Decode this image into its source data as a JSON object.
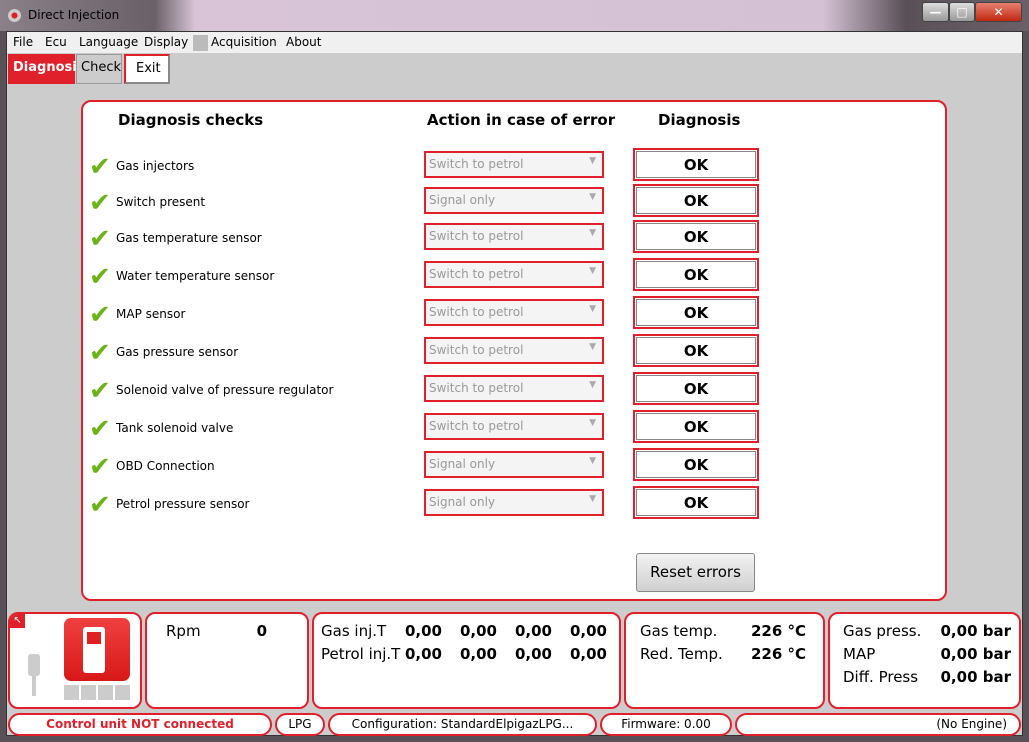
{
  "window": {
    "title": "Direct Injection",
    "minimize": "—",
    "maximize": "□",
    "close": "✕"
  },
  "menu": [
    "File",
    "Ecu",
    "Language",
    "Display",
    "Acquisition",
    "About"
  ],
  "tabs": [
    {
      "label": "Diagnosis",
      "active": true
    },
    {
      "label": "Check"
    },
    {
      "label": "Exit"
    }
  ],
  "headers": {
    "checks": "Diagnosis checks",
    "action": "Action in case of error",
    "diagnosis": "Diagnosis"
  },
  "checks": [
    {
      "label": "Gas injectors",
      "action": "Switch to petrol",
      "status": "OK"
    },
    {
      "label": "Switch present",
      "action": "Signal only",
      "status": "OK"
    },
    {
      "label": "Gas temperature sensor",
      "action": "Switch to petrol",
      "status": "OK"
    },
    {
      "label": "Water temperature sensor",
      "action": "Switch to petrol",
      "status": "OK"
    },
    {
      "label": "MAP sensor",
      "action": "Switch to petrol",
      "status": "OK"
    },
    {
      "label": "Gas pressure sensor",
      "action": "Switch to petrol",
      "status": "OK"
    },
    {
      "label": "Solenoid valve of pressure regulator",
      "action": "Switch to petrol",
      "status": "OK"
    },
    {
      "label": "Tank solenoid valve",
      "action": "Switch to petrol",
      "status": "OK"
    },
    {
      "label": "OBD Connection",
      "action": "Signal only",
      "status": "OK"
    },
    {
      "label": "Petrol pressure sensor",
      "action": "Signal only",
      "status": "OK"
    }
  ],
  "reset_label": "Reset errors",
  "gauges": {
    "rpm": {
      "label": "Rpm",
      "value": "0"
    },
    "gas_inj": {
      "label": "Gas inj.T",
      "values": [
        "0,00",
        "0,00",
        "0,00",
        "0,00"
      ]
    },
    "petrol_inj": {
      "label": "Petrol inj.T",
      "values": [
        "0,00",
        "0,00",
        "0,00",
        "0,00"
      ]
    },
    "gas_temp": {
      "label": "Gas temp.",
      "value": "226 °C"
    },
    "red_temp": {
      "label": "Red. Temp.",
      "value": "226 °C"
    },
    "gas_press": {
      "label": "Gas press.",
      "value": "0,00 bar"
    },
    "map": {
      "label": "MAP",
      "value": "0,00 bar"
    },
    "diff_press": {
      "label": "Diff. Press",
      "value": "0,00 bar"
    }
  },
  "status": {
    "connection": "Control unit NOT connected",
    "fuel": "LPG",
    "configuration": "Configuration: StandardElpigazLPG...",
    "firmware": "Firmware: 0.00",
    "engine": "(No Engine)"
  },
  "colors": {
    "accent": "#e0202a",
    "check": "#6ab418"
  }
}
